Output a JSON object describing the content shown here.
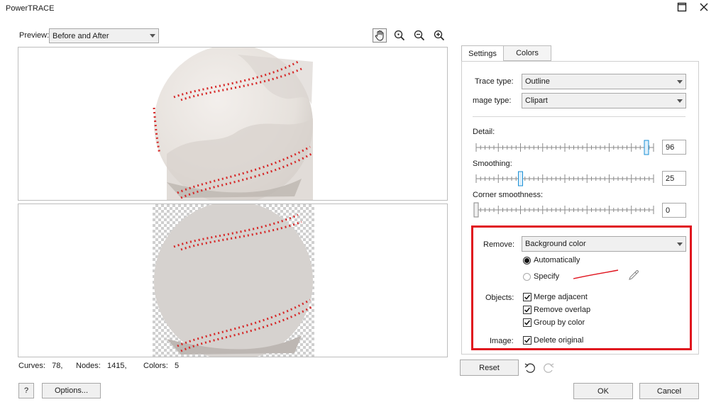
{
  "window": {
    "title": "PowerTRACE"
  },
  "preview": {
    "label": "Preview:",
    "value": "Before and After"
  },
  "tabs": [
    {
      "label": "Settings"
    },
    {
      "label": "Colors"
    }
  ],
  "settings": {
    "trace_type_label": "Trace type:",
    "trace_type_value": "Outline",
    "image_type_label": "mage type:",
    "image_type_value": "Clipart",
    "detail_label": "Detail:",
    "detail_value": "96",
    "smoothing_label": "Smoothing:",
    "smoothing_value": "25",
    "corner_label": "Corner smoothness:",
    "corner_value": "0",
    "sliders": {
      "detail": 0.96,
      "smoothing": 0.25,
      "corner": 0.0
    },
    "remove_label": "Remove:",
    "remove_value": "Background color",
    "automatically_label": "Automatically",
    "specify_label": "Specify",
    "objects_label": "Objects:",
    "merge_label": "Merge adjacent",
    "overlap_label": "Remove overlap",
    "group_label": "Group by color",
    "image_label": "Image:",
    "delete_label": "Delete original",
    "specify_swatch_color": "#e0141e"
  },
  "stats": {
    "curves_label": "Curves:",
    "curves_value": "78,",
    "nodes_label": "Nodes:",
    "nodes_value": "1415,",
    "colors_label": "Colors:",
    "colors_value": "5"
  },
  "buttons": {
    "reset": "Reset",
    "help": "?",
    "options": "Options...",
    "ok": "OK",
    "cancel": "Cancel"
  }
}
